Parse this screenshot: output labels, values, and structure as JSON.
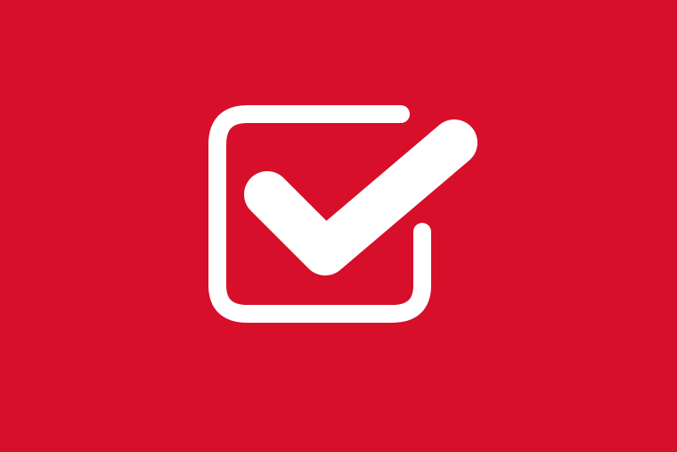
{
  "background": {
    "color": "#d70f2a"
  },
  "icon": {
    "name": "checkbox-checked-icon",
    "color": "#ffffff"
  }
}
